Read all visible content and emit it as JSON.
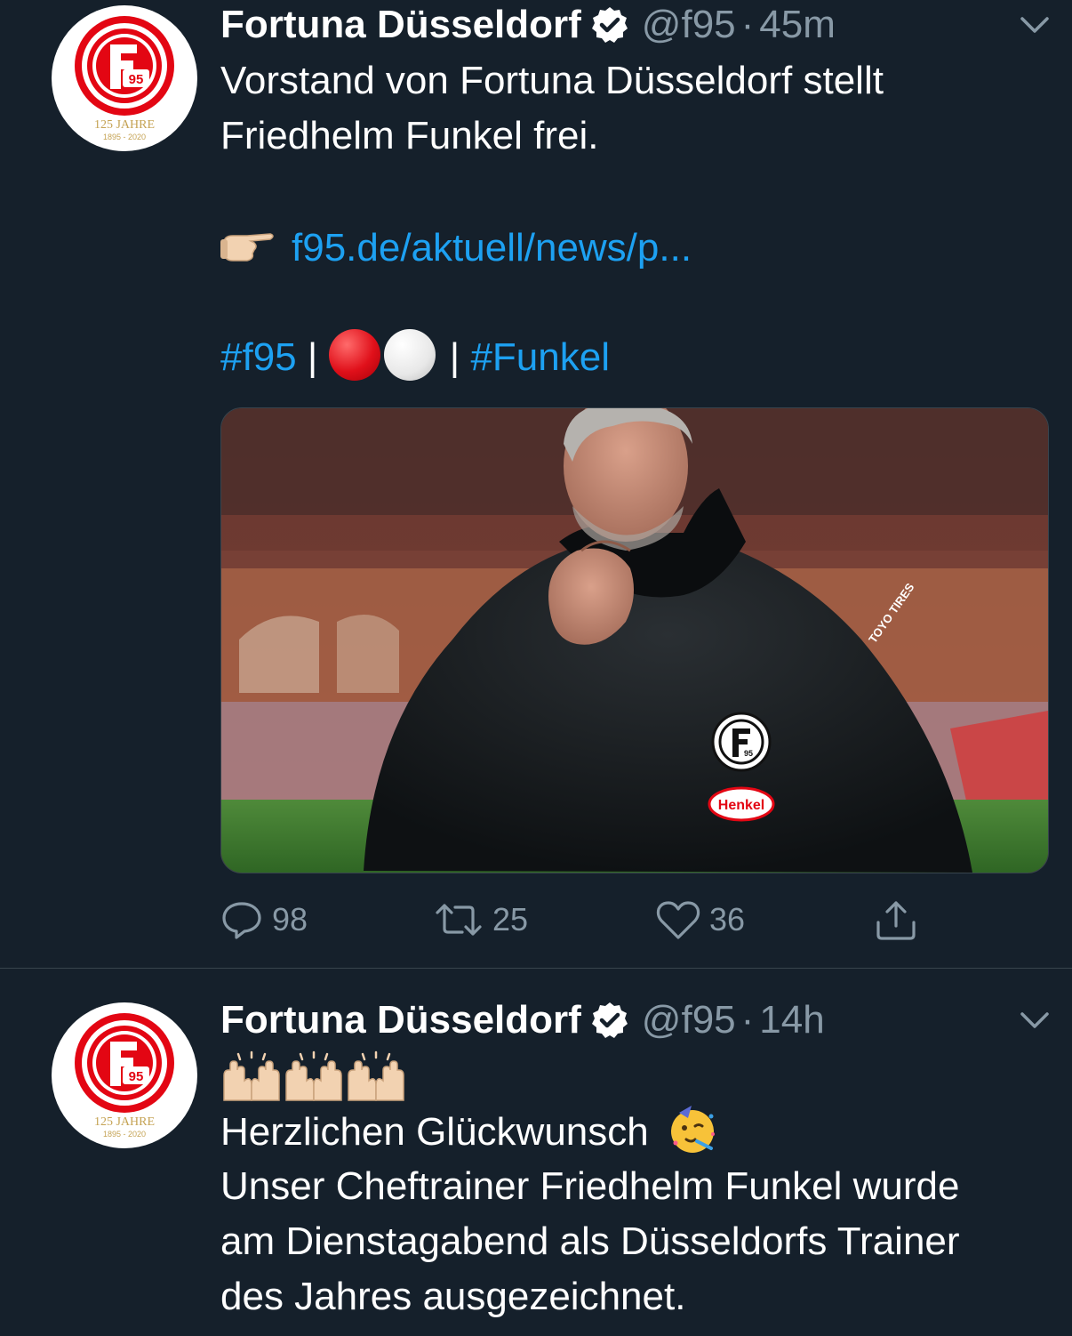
{
  "colors": {
    "background": "#15202b",
    "text_primary": "#ffffff",
    "text_secondary": "#8899a6",
    "link": "#1da1f2",
    "divider": "#38444d",
    "club_red": "#e30613"
  },
  "tweets": [
    {
      "author": {
        "name": "Fortuna Düsseldorf",
        "verified": true,
        "handle": "@f95",
        "avatar": {
          "badge_number": "95",
          "anniversary_text": "125 JAHRE",
          "anniversary_years": "1895 - 2020"
        }
      },
      "time": "45m",
      "dot": "·",
      "text_lines": [
        "Vorstand von Fortuna Düsseldorf stellt",
        "Friedhelm Funkel frei."
      ],
      "link_icon": "backhand-index-pointing-right-icon",
      "link_text": "f95.de/aktuell/news/p...",
      "hashtag_1": "#f95",
      "separator": "|",
      "hashtag_2": "#Funkel",
      "emoji_icons": [
        "red-circle-icon",
        "white-circle-icon"
      ],
      "media": {
        "jacket_badge_number": "95",
        "sponsor_text": "Henkel",
        "sleeve_text": "TOYO TIRES"
      },
      "stats": {
        "replies": "98",
        "retweets": "25",
        "likes": "36"
      }
    },
    {
      "author": {
        "name": "Fortuna Düsseldorf",
        "verified": true,
        "handle": "@f95",
        "avatar": {
          "badge_number": "95",
          "anniversary_text": "125 JAHRE",
          "anniversary_years": "1895 - 2020"
        }
      },
      "time": "14h",
      "dot": "·",
      "emoji_icons": [
        "raising-hands-icon",
        "raising-hands-icon",
        "raising-hands-icon",
        "partying-face-icon"
      ],
      "text_lines": [
        "Herzlichen Glückwunsch",
        "Unser Cheftrainer Friedhelm Funkel wurde",
        "am Dienstagabend als Düsseldorfs Trainer",
        "des Jahres ausgezeichnet."
      ]
    }
  ]
}
